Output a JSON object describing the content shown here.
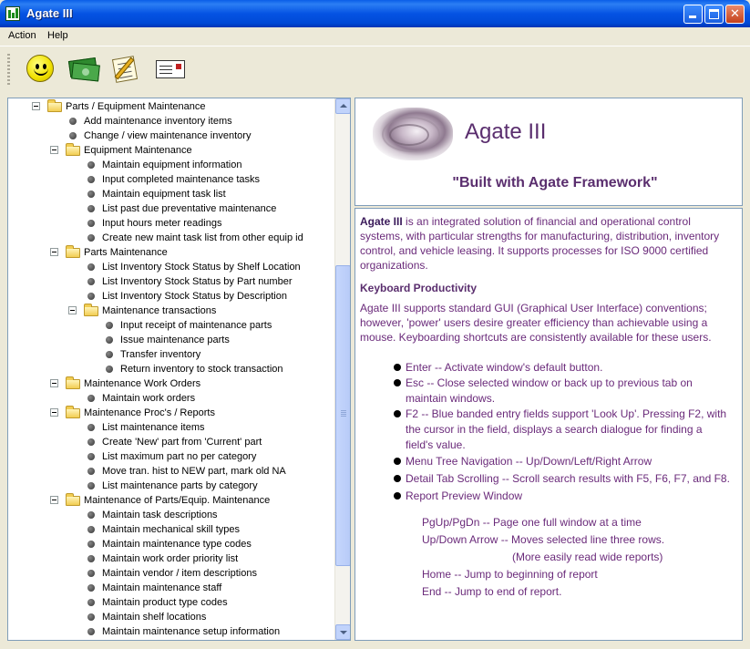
{
  "window": {
    "title": "Agate III"
  },
  "menu": [
    "Action",
    "Help"
  ],
  "toolbar": {
    "buttons": [
      {
        "name": "smiley-icon"
      },
      {
        "name": "money-icon"
      },
      {
        "name": "checklist-pencil-icon"
      },
      {
        "name": "envelope-icon"
      }
    ]
  },
  "tree": {
    "items": [
      {
        "label": "Parts / Equipment Maintenance",
        "type": "folder",
        "level": 0
      },
      {
        "label": "Add maintenance inventory items",
        "type": "leaf",
        "level": 1
      },
      {
        "label": "Change / view maintenance inventory",
        "type": "leaf",
        "level": 1
      },
      {
        "label": "Equipment Maintenance",
        "type": "folder",
        "level": 1
      },
      {
        "label": "Maintain equipment information",
        "type": "leaf",
        "level": 2
      },
      {
        "label": "Input completed maintenance tasks",
        "type": "leaf",
        "level": 2
      },
      {
        "label": "Maintain equipment task list",
        "type": "leaf",
        "level": 2
      },
      {
        "label": "List past due preventative maintenance",
        "type": "leaf",
        "level": 2
      },
      {
        "label": "Input hours meter readings",
        "type": "leaf",
        "level": 2
      },
      {
        "label": "Create new maint task list from other equip id",
        "type": "leaf",
        "level": 2
      },
      {
        "label": "Parts Maintenance",
        "type": "folder",
        "level": 1
      },
      {
        "label": "List Inventory Stock Status by Shelf Location",
        "type": "leaf",
        "level": 2
      },
      {
        "label": "List Inventory Stock Status by Part number",
        "type": "leaf",
        "level": 2
      },
      {
        "label": "List Inventory Stock Status by Description",
        "type": "leaf",
        "level": 2
      },
      {
        "label": "Maintenance transactions",
        "type": "folder",
        "level": 2
      },
      {
        "label": "Input receipt of maintenance parts",
        "type": "leaf",
        "level": 3
      },
      {
        "label": "Issue maintenance parts",
        "type": "leaf",
        "level": 3
      },
      {
        "label": "Transfer inventory",
        "type": "leaf",
        "level": 3
      },
      {
        "label": "Return inventory to stock transaction",
        "type": "leaf",
        "level": 3
      },
      {
        "label": "Maintenance Work Orders",
        "type": "folder",
        "level": 1
      },
      {
        "label": "Maintain work orders",
        "type": "leaf",
        "level": 2
      },
      {
        "label": "Maintenance Proc's / Reports",
        "type": "folder",
        "level": 1
      },
      {
        "label": "List maintenance items",
        "type": "leaf",
        "level": 2
      },
      {
        "label": "Create 'New' part from 'Current' part",
        "type": "leaf",
        "level": 2
      },
      {
        "label": "List maximum part no per category",
        "type": "leaf",
        "level": 2
      },
      {
        "label": "Move tran. hist to NEW part, mark old NA",
        "type": "leaf",
        "level": 2
      },
      {
        "label": "List maintenance parts by category",
        "type": "leaf",
        "level": 2
      },
      {
        "label": "Maintenance of Parts/Equip. Maintenance",
        "type": "folder",
        "level": 1
      },
      {
        "label": "Maintain task descriptions",
        "type": "leaf",
        "level": 2
      },
      {
        "label": "Maintain mechanical skill types",
        "type": "leaf",
        "level": 2
      },
      {
        "label": "Maintain maintenance type codes",
        "type": "leaf",
        "level": 2
      },
      {
        "label": "Maintain work order priority list",
        "type": "leaf",
        "level": 2
      },
      {
        "label": "Maintain vendor / item descriptions",
        "type": "leaf",
        "level": 2
      },
      {
        "label": "Maintain maintenance staff",
        "type": "leaf",
        "level": 2
      },
      {
        "label": "Maintain product type codes",
        "type": "leaf",
        "level": 2
      },
      {
        "label": "Maintain shelf locations",
        "type": "leaf",
        "level": 2
      },
      {
        "label": "Maintain maintenance setup information",
        "type": "leaf",
        "level": 2
      }
    ]
  },
  "header": {
    "app_name": "Agate III",
    "tagline": "\"Built with Agate Framework\""
  },
  "content": {
    "intro_bold": "Agate III",
    "intro_lines": [
      " is an integrated solution of financial and operational control",
      "systems, with particular strengths for manufacturing, distribution, inventory",
      "control, and vehicle leasing.  It supports processes for ISO 9000 certified",
      "organizations."
    ],
    "section_heading": "Keyboard Productivity",
    "section_lines": [
      "Agate III supports standard GUI (Graphical User Interface) conventions;",
      "however, 'power' users desire greater efficiency than achievable using a",
      "mouse.  Keyboarding shortcuts are consistently available for these users."
    ],
    "bullets": [
      {
        "lines": [
          "Enter -- Activate window's default button."
        ]
      },
      {
        "lines": [
          "Esc -- Close selected window or back up to previous tab on",
          "maintain windows."
        ]
      },
      {
        "lines": [
          "F2 -- Blue banded entry fields support 'Look Up'.  Pressing F2, with",
          "the cursor in the field, displays a search dialogue for finding a",
          "field's value."
        ]
      },
      {
        "lines": [
          "Menu Tree Navigation -- Up/Down/Left/Right Arrow"
        ]
      },
      {
        "lines": [
          "Detail Tab Scrolling -- Scroll search results with F5, F6, F7, and F8."
        ]
      },
      {
        "lines": [
          "Report Preview Window"
        ]
      }
    ],
    "report_keys": [
      "PgUp/PgDn -- Page one full window at a time",
      "Up/Down Arrow -- Moves selected line three rows.",
      "(More easily read wide reports)",
      "Home -- Jump to beginning of report",
      "End   --   Jump to end of report."
    ]
  },
  "colors": {
    "titlebar": "#0553e3",
    "accent_text": "#6a2a7a",
    "window_bg": "#ece9d8"
  }
}
